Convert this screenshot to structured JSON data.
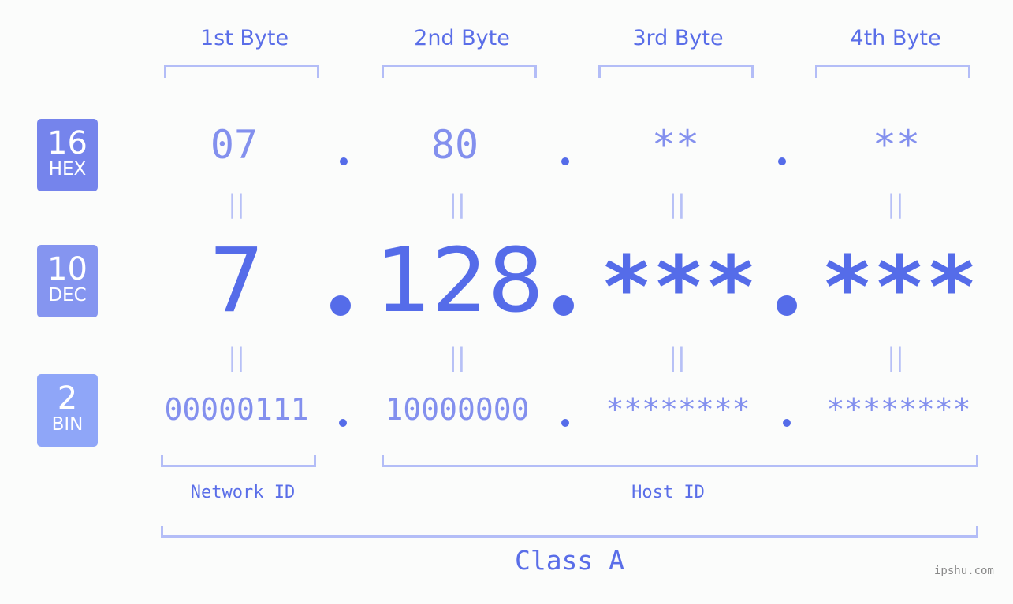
{
  "headers": [
    "1st Byte",
    "2nd Byte",
    "3rd Byte",
    "4th Byte"
  ],
  "badges": {
    "hex": {
      "num": "16",
      "label": "HEX",
      "color": "#7584ec"
    },
    "dec": {
      "num": "10",
      "label": "DEC",
      "color": "#8595f0"
    },
    "bin": {
      "num": "2",
      "label": "BIN",
      "color": "#8fa6f8"
    }
  },
  "hex": [
    "07",
    "80",
    "**",
    "**"
  ],
  "dec": [
    "7",
    "128",
    "***",
    "***"
  ],
  "bin": [
    "00000111",
    "10000000",
    "********",
    "********"
  ],
  "equals_symbol": "||",
  "labels": {
    "network_id": "Network ID",
    "host_id": "Host ID",
    "class": "Class A"
  },
  "watermark": "ipshu.com",
  "colors": {
    "primary": "#556ce9",
    "light": "#8390ee",
    "bracket": "#b3bdf7"
  }
}
